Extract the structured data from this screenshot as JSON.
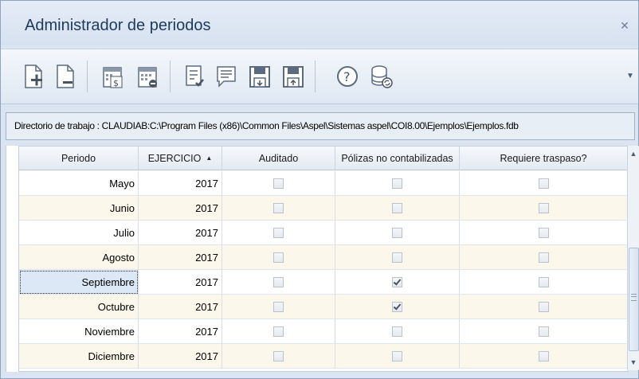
{
  "window": {
    "title": "Administrador de periodos"
  },
  "toolbar": {
    "icons": [
      "new-doc-add-icon",
      "new-doc-remove-icon",
      "calendar-money-icon",
      "calendar-close-icon",
      "document-check-icon",
      "comment-list-icon",
      "save-export-icon",
      "save-import-icon",
      "help-icon",
      "database-refresh-icon"
    ]
  },
  "directory": {
    "text": "Directorio de trabajo : CLAUDIAB:C:\\Program Files (x86)\\Common Files\\Aspel\\Sistemas aspel\\COI8.00\\Ejemplos\\Ejemplos.fdb"
  },
  "grid": {
    "columns": [
      "Periodo",
      "EJERCICIO",
      "Auditado",
      "Pólizas no contabilizadas",
      "Requiere traspaso?"
    ],
    "sort_column": "EJERCICIO",
    "sort_direction": "ascending",
    "selected_row": 4,
    "rows": [
      {
        "periodo": "Mayo",
        "ejercicio": "2017",
        "auditado": false,
        "polizas": false,
        "traspaso": false
      },
      {
        "periodo": "Junio",
        "ejercicio": "2017",
        "auditado": false,
        "polizas": false,
        "traspaso": false
      },
      {
        "periodo": "Julio",
        "ejercicio": "2017",
        "auditado": false,
        "polizas": false,
        "traspaso": false
      },
      {
        "periodo": "Agosto",
        "ejercicio": "2017",
        "auditado": false,
        "polizas": false,
        "traspaso": false
      },
      {
        "periodo": "Septiembre",
        "ejercicio": "2017",
        "auditado": false,
        "polizas": true,
        "traspaso": false
      },
      {
        "periodo": "Octubre",
        "ejercicio": "2017",
        "auditado": false,
        "polizas": true,
        "traspaso": false
      },
      {
        "periodo": "Noviembre",
        "ejercicio": "2017",
        "auditado": false,
        "polizas": false,
        "traspaso": false
      },
      {
        "periodo": "Diciembre",
        "ejercicio": "2017",
        "auditado": false,
        "polizas": false,
        "traspaso": false
      }
    ]
  },
  "colors": {
    "row_alt": "#fbf7ea",
    "row": "#ffffff",
    "accent": "#1e395b"
  }
}
